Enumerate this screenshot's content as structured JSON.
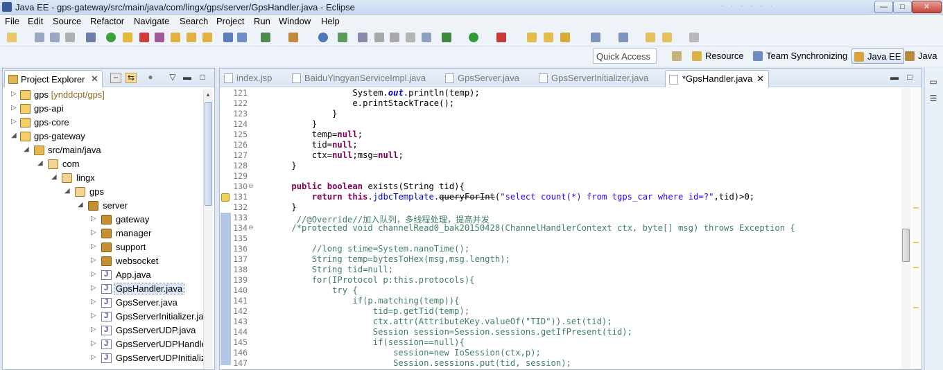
{
  "window": {
    "title": "Java EE - gps-gateway/src/main/java/com/lingx/gps/server/GpsHandler.java - Eclipse",
    "min_glyph": "—",
    "max_glyph": "□",
    "close_glyph": "✕"
  },
  "menu": [
    "File",
    "Edit",
    "Source",
    "Refactor",
    "Navigate",
    "Search",
    "Project",
    "Run",
    "Window",
    "Help"
  ],
  "quick_access": {
    "placeholder": "Quick Access"
  },
  "perspectives": [
    "Resource",
    "Team Synchronizing",
    "Java EE",
    "Java"
  ],
  "project_explorer": {
    "title": "Project Explorer",
    "close_glyph": "✕",
    "tree": [
      {
        "label": "gps",
        "decoration": " [ynddcpt/gps]",
        "icon": "project-icon",
        "twisty": "▷"
      },
      {
        "label": "gps-api",
        "icon": "project-icon",
        "twisty": "▷"
      },
      {
        "label": "gps-core",
        "icon": "project-icon",
        "twisty": "▷"
      },
      {
        "label": "gps-gateway",
        "icon": "project-icon",
        "twisty": "◢"
      },
      {
        "label": "src/main/java",
        "icon": "source-folder-icon",
        "twisty": "◢"
      },
      {
        "label": "com",
        "icon": "package-icon",
        "twisty": "◢"
      },
      {
        "label": "lingx",
        "icon": "package-icon",
        "twisty": "◢"
      },
      {
        "label": "gps",
        "icon": "package-icon",
        "twisty": "◢"
      },
      {
        "label": "server",
        "icon": "package-icon",
        "twisty": "◢"
      },
      {
        "label": "gateway",
        "icon": "package-icon",
        "twisty": "▷"
      },
      {
        "label": "manager",
        "icon": "package-icon",
        "twisty": "▷"
      },
      {
        "label": "support",
        "icon": "package-icon",
        "twisty": "▷"
      },
      {
        "label": "websocket",
        "icon": "package-icon",
        "twisty": "▷"
      },
      {
        "label": "App.java",
        "icon": "java-file-icon",
        "twisty": "▷"
      },
      {
        "label": "GpsHandler.java",
        "icon": "java-file-icon",
        "twisty": "▷",
        "selected": true
      },
      {
        "label": "GpsServer.java",
        "icon": "java-file-icon",
        "twisty": "▷"
      },
      {
        "label": "GpsServerInitializer.java",
        "icon": "java-file-icon",
        "twisty": "▷"
      },
      {
        "label": "GpsServerUDP.java",
        "icon": "java-file-icon",
        "twisty": "▷"
      },
      {
        "label": "GpsServerUDPHandler.java",
        "icon": "java-file-icon",
        "twisty": "▷"
      },
      {
        "label": "GpsServerUDPInitializer.java",
        "icon": "java-file-icon",
        "twisty": "▷"
      }
    ]
  },
  "editor": {
    "tabs": [
      "index.jsp",
      "BaiduYingyanServiceImpl.java",
      "GpsServer.java",
      "GpsServerInitializer.java",
      "*GpsHandler.java"
    ],
    "active_tab": "*GpsHandler.java",
    "tab_close_glyph": "✕",
    "line_numbers": [
      "121",
      "122",
      "123",
      "124",
      "125",
      "126",
      "127",
      "128",
      "129",
      "130",
      "131",
      "132",
      "133",
      "134",
      "135",
      "136",
      "137",
      "138",
      "139",
      "140",
      "141",
      "142",
      "143",
      "144",
      "145",
      "146",
      "147"
    ],
    "lines": [
      "                System.out.println(temp);",
      "                e.printStackTrace();",
      "            }",
      "        }",
      "        temp=null;",
      "        tid=null;",
      "        ctx=null;msg=null;",
      "    }",
      "",
      "    public boolean exists(String tid){",
      "        return this.jdbcTemplate.queryForInt(\"select count(*) from tgps_car where id=?\",tid)>0;",
      "    }",
      "     //@Override//加入队列，多线程处理，提高并发",
      "    /*protected void channelRead0_bak20150428(ChannelHandlerContext ctx, byte[] msg) throws Exception {",
      "",
      "        //long stime=System.nanoTime();",
      "        String temp=bytesToHex(msg,msg.length);",
      "        String tid=null;",
      "        for(IProtocol p:this.protocols){",
      "            try {",
      "                if(p.matching(temp)){",
      "                    tid=p.getTid(temp);",
      "                    ctx.attr(AttributeKey.valueOf(\"TID\")).set(tid);",
      "                    Session session=Session.sessions.getIfPresent(tid);",
      "                    if(session==null){",
      "                        session=new IoSession(ctx,p);",
      "                        Session.sessions.put(tid, session);"
    ]
  }
}
